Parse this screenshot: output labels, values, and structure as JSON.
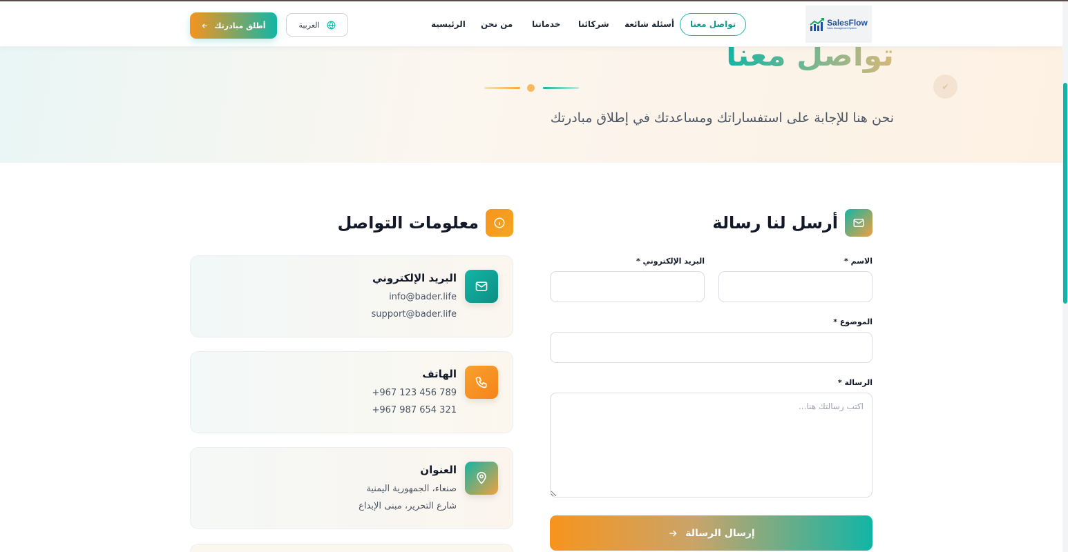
{
  "brand": {
    "name": "SalesFlow",
    "tagline": "Sales Management System"
  },
  "nav": {
    "items": [
      {
        "label": "تواصل معنا",
        "active": true
      },
      {
        "label": "أسئلة شائعة"
      },
      {
        "label": "شركائنا"
      },
      {
        "label": "خدماتنا"
      },
      {
        "label": "من نحن"
      },
      {
        "label": "الرئيسية"
      }
    ],
    "language": "العربية",
    "cta": "أطلق مبادرتك"
  },
  "hero": {
    "title": "تواصل معنا",
    "subtitle": "نحن هنا للإجابة على استفساراتك ومساعدتك في إطلاق مبادرتك"
  },
  "form": {
    "title": "أرسل لنا رسالة",
    "name_label": "الاسم *",
    "email_label": "البريد الإلكتروني *",
    "subject_label": "الموضوع *",
    "message_label": "الرسالة *",
    "message_placeholder": "اكتب رسالتك هنا...",
    "submit": "إرسال الرسالة"
  },
  "contact_info": {
    "title": "معلومات التواصل",
    "cards": [
      {
        "title": "البريد الإلكتروني",
        "lines": [
          "info@bader.life",
          "support@bader.life"
        ]
      },
      {
        "title": "الهاتف",
        "lines": [
          "+967 123 456 789",
          "+967 987 654 321"
        ]
      },
      {
        "title": "العنوان",
        "lines": [
          "صنعاء، الجمهورية اليمنية",
          "شارع التحرير، مبنى الإبداع"
        ]
      }
    ]
  },
  "colors": {
    "primary": "#12b5a5",
    "accent": "#f7941d"
  }
}
